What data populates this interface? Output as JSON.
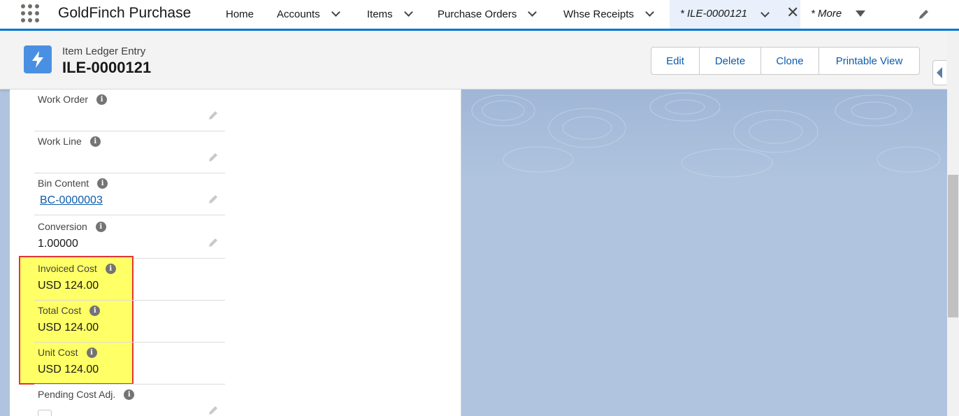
{
  "app": {
    "name": "GoldFinch Purchase"
  },
  "nav": {
    "items": [
      {
        "label": "Home",
        "has_menu": false
      },
      {
        "label": "Accounts",
        "has_menu": true
      },
      {
        "label": "Items",
        "has_menu": true
      },
      {
        "label": "Purchase Orders",
        "has_menu": true
      },
      {
        "label": "Whse Receipts",
        "has_menu": true
      }
    ],
    "active_tab": {
      "label": "* ILE-0000121"
    },
    "more_label": "* More"
  },
  "header": {
    "object_type": "Item Ledger Entry",
    "record_name": "ILE-0000121",
    "buttons": [
      "Edit",
      "Delete",
      "Clone",
      "Printable View"
    ]
  },
  "fields": [
    {
      "label": "Work Order",
      "value": ""
    },
    {
      "label": "Work Line",
      "value": ""
    },
    {
      "label": "Bin Content",
      "value": "BC-0000003"
    },
    {
      "label": "Conversion",
      "value": "1.00000"
    },
    {
      "label": "Invoiced Cost",
      "value": "USD 124.00"
    },
    {
      "label": "Total Cost",
      "value": "USD 124.00"
    },
    {
      "label": "Unit Cost",
      "value": "USD 124.00"
    },
    {
      "label": "Pending Cost Adj.",
      "checked": false
    }
  ],
  "colors": {
    "brand": "#0176d3",
    "highlight": "#ffff66",
    "highlight_border": "#e23434",
    "background": "#b0c4df"
  }
}
